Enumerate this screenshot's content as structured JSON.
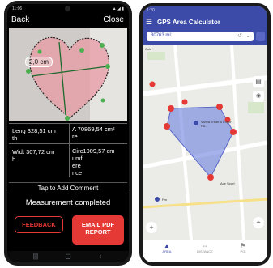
{
  "left": {
    "status_time": "11:06",
    "status_right": "▲ ◢ ▮",
    "back_label": "Back",
    "close_label": "Close",
    "measure_chip": "2,0 cm",
    "length_label": "Leng 328,51 cm",
    "length_suffix": "th",
    "area_label": "A 70869,54 cm²",
    "area_suffix": "re",
    "width_label": "Widt 307,72 cm",
    "width_suffix": "h",
    "circ_label": "Circ1009,57 cm",
    "circ_lines": [
      "umf",
      "ere",
      "nce"
    ],
    "comment_label": "Tap to Add Comment",
    "status_text": "Measurement completed",
    "feedback_label": "FEEDBACK",
    "email_label_1": "EMAIL PDF",
    "email_label_2": "REPORT",
    "colors": {
      "accent": "#e53935",
      "shape_fill": "#e89aa4"
    }
  },
  "right": {
    "status_time": "1:20",
    "app_title": "GPS Area Calculator",
    "area_value": "30763 m²",
    "map_label_1": "Vanya Trade & Export Hu...",
    "map_label_2": "Ace Sport",
    "map_label_3": "Pm",
    "map_label_4": "Cole",
    "nav_items": [
      {
        "label": "AREA",
        "icon": "area-icon"
      },
      {
        "label": "DISTANCE",
        "icon": "distance-icon"
      },
      {
        "label": "POI",
        "icon": "poi-icon"
      }
    ],
    "colors": {
      "header": "#3c4aa8",
      "polygon": "#6b7fe0",
      "pin": "#e53935"
    }
  }
}
